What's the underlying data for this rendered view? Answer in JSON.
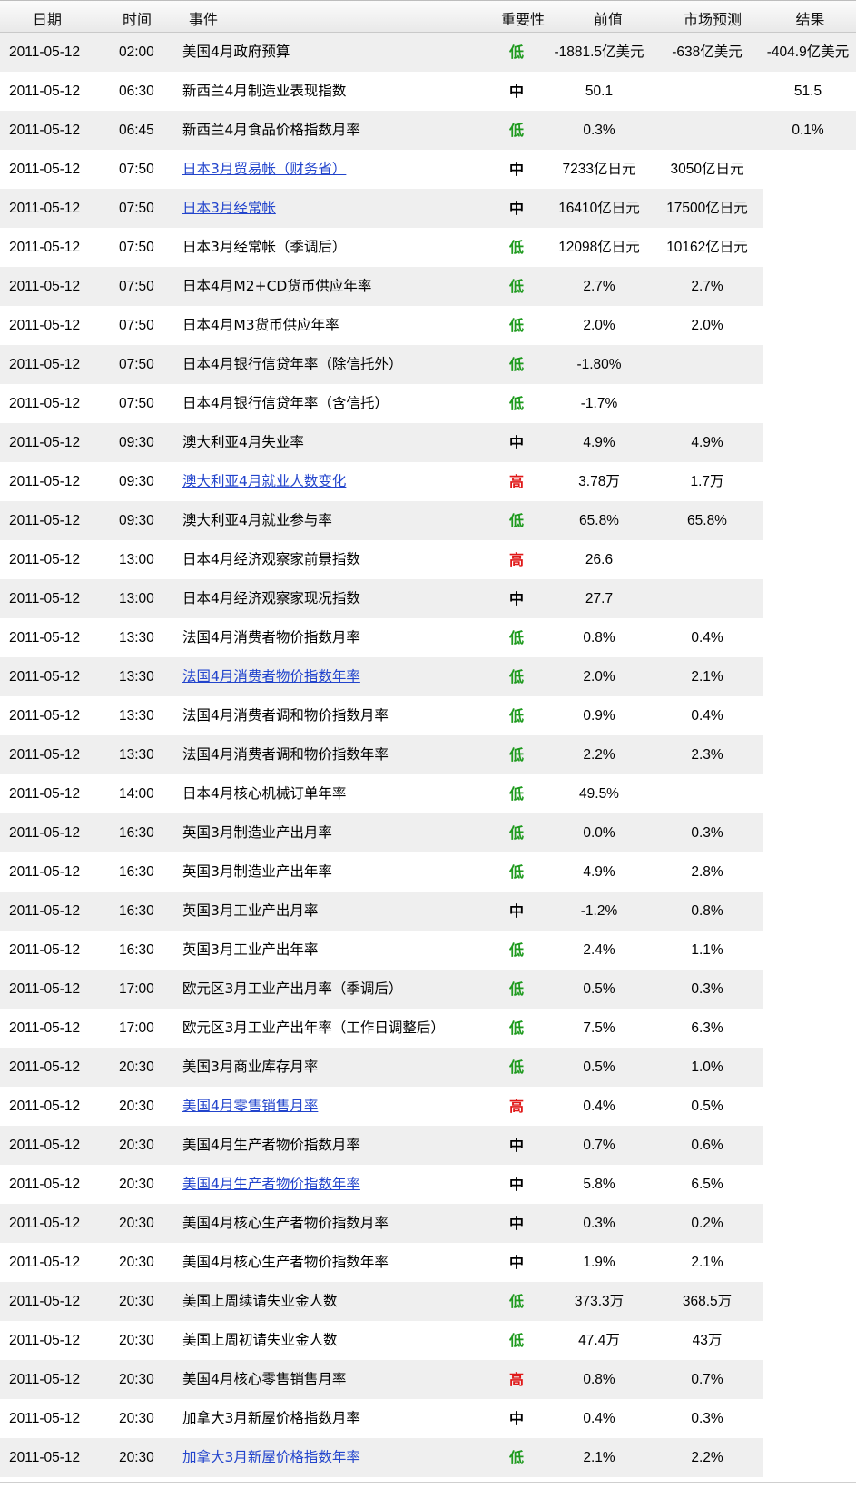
{
  "header": {
    "date": "日期",
    "time": "时间",
    "event": "事件",
    "importance": "重要性",
    "previous": "前值",
    "forecast": "市场预测",
    "actual": "结果"
  },
  "colors": {
    "low": "#1e9a1e",
    "medium": "#1a2fd6",
    "high": "#e01818",
    "link": "#2244cc",
    "alt_row": "#efefef"
  },
  "rows": [
    {
      "date": "2011-05-12",
      "time": "02:00",
      "event": "美国4月政府预算",
      "link": false,
      "importance": "低",
      "level": "low",
      "previous": "-1881.5亿美元",
      "forecast": "-638亿美元",
      "actual": "-404.9亿美元"
    },
    {
      "date": "2011-05-12",
      "time": "06:30",
      "event": "新西兰4月制造业表现指数",
      "link": false,
      "importance": "中",
      "level": "medium",
      "previous": "50.1",
      "forecast": "",
      "actual": "51.5"
    },
    {
      "date": "2011-05-12",
      "time": "06:45",
      "event": "新西兰4月食品价格指数月率",
      "link": false,
      "importance": "低",
      "level": "low",
      "previous": "0.3%",
      "forecast": "",
      "actual": "0.1%"
    },
    {
      "date": "2011-05-12",
      "time": "07:50",
      "event": "日本3月贸易帐（财务省）",
      "link": true,
      "importance": "中",
      "level": "medium",
      "previous": "7233亿日元",
      "forecast": "3050亿日元",
      "actual": ""
    },
    {
      "date": "2011-05-12",
      "time": "07:50",
      "event": "日本3月经常帐",
      "link": true,
      "importance": "中",
      "level": "medium",
      "previous": "16410亿日元",
      "forecast": "17500亿日元",
      "actual": ""
    },
    {
      "date": "2011-05-12",
      "time": "07:50",
      "event": "日本3月经常帐（季调后）",
      "link": false,
      "importance": "低",
      "level": "low",
      "previous": "12098亿日元",
      "forecast": "10162亿日元",
      "actual": ""
    },
    {
      "date": "2011-05-12",
      "time": "07:50",
      "event": "日本4月M2+CD货币供应年率",
      "link": false,
      "importance": "低",
      "level": "low",
      "previous": "2.7%",
      "forecast": "2.7%",
      "actual": ""
    },
    {
      "date": "2011-05-12",
      "time": "07:50",
      "event": "日本4月M3货币供应年率",
      "link": false,
      "importance": "低",
      "level": "low",
      "previous": "2.0%",
      "forecast": "2.0%",
      "actual": ""
    },
    {
      "date": "2011-05-12",
      "time": "07:50",
      "event": "日本4月银行信贷年率（除信托外）",
      "link": false,
      "importance": "低",
      "level": "low",
      "previous": "-1.80%",
      "forecast": "",
      "actual": ""
    },
    {
      "date": "2011-05-12",
      "time": "07:50",
      "event": "日本4月银行信贷年率（含信托）",
      "link": false,
      "importance": "低",
      "level": "low",
      "previous": "-1.7%",
      "forecast": "",
      "actual": ""
    },
    {
      "date": "2011-05-12",
      "time": "09:30",
      "event": "澳大利亚4月失业率",
      "link": false,
      "importance": "中",
      "level": "medium",
      "previous": "4.9%",
      "forecast": "4.9%",
      "actual": ""
    },
    {
      "date": "2011-05-12",
      "time": "09:30",
      "event": "澳大利亚4月就业人数变化",
      "link": true,
      "importance": "高",
      "level": "high",
      "previous": "3.78万",
      "forecast": "1.7万",
      "actual": ""
    },
    {
      "date": "2011-05-12",
      "time": "09:30",
      "event": "澳大利亚4月就业参与率",
      "link": false,
      "importance": "低",
      "level": "low",
      "previous": "65.8%",
      "forecast": "65.8%",
      "actual": ""
    },
    {
      "date": "2011-05-12",
      "time": "13:00",
      "event": "日本4月经济观察家前景指数",
      "link": false,
      "importance": "高",
      "level": "high",
      "previous": "26.6",
      "forecast": "",
      "actual": ""
    },
    {
      "date": "2011-05-12",
      "time": "13:00",
      "event": "日本4月经济观察家现况指数",
      "link": false,
      "importance": "中",
      "level": "medium",
      "previous": "27.7",
      "forecast": "",
      "actual": ""
    },
    {
      "date": "2011-05-12",
      "time": "13:30",
      "event": "法国4月消费者物价指数月率",
      "link": false,
      "importance": "低",
      "level": "low",
      "previous": "0.8%",
      "forecast": "0.4%",
      "actual": ""
    },
    {
      "date": "2011-05-12",
      "time": "13:30",
      "event": "法国4月消费者物价指数年率",
      "link": true,
      "importance": "低",
      "level": "low",
      "previous": "2.0%",
      "forecast": "2.1%",
      "actual": ""
    },
    {
      "date": "2011-05-12",
      "time": "13:30",
      "event": "法国4月消费者调和物价指数月率",
      "link": false,
      "importance": "低",
      "level": "low",
      "previous": "0.9%",
      "forecast": "0.4%",
      "actual": ""
    },
    {
      "date": "2011-05-12",
      "time": "13:30",
      "event": "法国4月消费者调和物价指数年率",
      "link": false,
      "importance": "低",
      "level": "low",
      "previous": "2.2%",
      "forecast": "2.3%",
      "actual": ""
    },
    {
      "date": "2011-05-12",
      "time": "14:00",
      "event": "日本4月核心机械订单年率",
      "link": false,
      "importance": "低",
      "level": "low",
      "previous": "49.5%",
      "forecast": "",
      "actual": ""
    },
    {
      "date": "2011-05-12",
      "time": "16:30",
      "event": "英国3月制造业产出月率",
      "link": false,
      "importance": "低",
      "level": "low",
      "previous": "0.0%",
      "forecast": "0.3%",
      "actual": ""
    },
    {
      "date": "2011-05-12",
      "time": "16:30",
      "event": "英国3月制造业产出年率",
      "link": false,
      "importance": "低",
      "level": "low",
      "previous": "4.9%",
      "forecast": "2.8%",
      "actual": ""
    },
    {
      "date": "2011-05-12",
      "time": "16:30",
      "event": "英国3月工业产出月率",
      "link": false,
      "importance": "中",
      "level": "medium",
      "previous": "-1.2%",
      "forecast": "0.8%",
      "actual": ""
    },
    {
      "date": "2011-05-12",
      "time": "16:30",
      "event": "英国3月工业产出年率",
      "link": false,
      "importance": "低",
      "level": "low",
      "previous": "2.4%",
      "forecast": "1.1%",
      "actual": ""
    },
    {
      "date": "2011-05-12",
      "time": "17:00",
      "event": "欧元区3月工业产出月率（季调后）",
      "link": false,
      "importance": "低",
      "level": "low",
      "previous": "0.5%",
      "forecast": "0.3%",
      "actual": ""
    },
    {
      "date": "2011-05-12",
      "time": "17:00",
      "event": "欧元区3月工业产出年率（工作日调整后）",
      "link": false,
      "importance": "低",
      "level": "low",
      "previous": "7.5%",
      "forecast": "6.3%",
      "actual": ""
    },
    {
      "date": "2011-05-12",
      "time": "20:30",
      "event": "美国3月商业库存月率",
      "link": false,
      "importance": "低",
      "level": "low",
      "previous": "0.5%",
      "forecast": "1.0%",
      "actual": ""
    },
    {
      "date": "2011-05-12",
      "time": "20:30",
      "event": "美国4月零售销售月率",
      "link": true,
      "importance": "高",
      "level": "high",
      "previous": "0.4%",
      "forecast": "0.5%",
      "actual": ""
    },
    {
      "date": "2011-05-12",
      "time": "20:30",
      "event": "美国4月生产者物价指数月率",
      "link": false,
      "importance": "中",
      "level": "medium",
      "previous": "0.7%",
      "forecast": "0.6%",
      "actual": ""
    },
    {
      "date": "2011-05-12",
      "time": "20:30",
      "event": "美国4月生产者物价指数年率",
      "link": true,
      "importance": "中",
      "level": "medium",
      "previous": "5.8%",
      "forecast": "6.5%",
      "actual": ""
    },
    {
      "date": "2011-05-12",
      "time": "20:30",
      "event": "美国4月核心生产者物价指数月率",
      "link": false,
      "importance": "中",
      "level": "medium",
      "previous": "0.3%",
      "forecast": "0.2%",
      "actual": ""
    },
    {
      "date": "2011-05-12",
      "time": "20:30",
      "event": "美国4月核心生产者物价指数年率",
      "link": false,
      "importance": "中",
      "level": "medium",
      "previous": "1.9%",
      "forecast": "2.1%",
      "actual": ""
    },
    {
      "date": "2011-05-12",
      "time": "20:30",
      "event": "美国上周续请失业金人数",
      "link": false,
      "importance": "低",
      "level": "low",
      "previous": "373.3万",
      "forecast": "368.5万",
      "actual": ""
    },
    {
      "date": "2011-05-12",
      "time": "20:30",
      "event": "美国上周初请失业金人数",
      "link": false,
      "importance": "低",
      "level": "low",
      "previous": "47.4万",
      "forecast": "43万",
      "actual": ""
    },
    {
      "date": "2011-05-12",
      "time": "20:30",
      "event": "美国4月核心零售销售月率",
      "link": false,
      "importance": "高",
      "level": "high",
      "previous": "0.8%",
      "forecast": "0.7%",
      "actual": ""
    },
    {
      "date": "2011-05-12",
      "time": "20:30",
      "event": "加拿大3月新屋价格指数月率",
      "link": false,
      "importance": "中",
      "level": "medium",
      "previous": "0.4%",
      "forecast": "0.3%",
      "actual": ""
    },
    {
      "date": "2011-05-12",
      "time": "20:30",
      "event": "加拿大3月新屋价格指数年率",
      "link": true,
      "importance": "低",
      "level": "low",
      "previous": "2.1%",
      "forecast": "2.2%",
      "actual": ""
    }
  ]
}
